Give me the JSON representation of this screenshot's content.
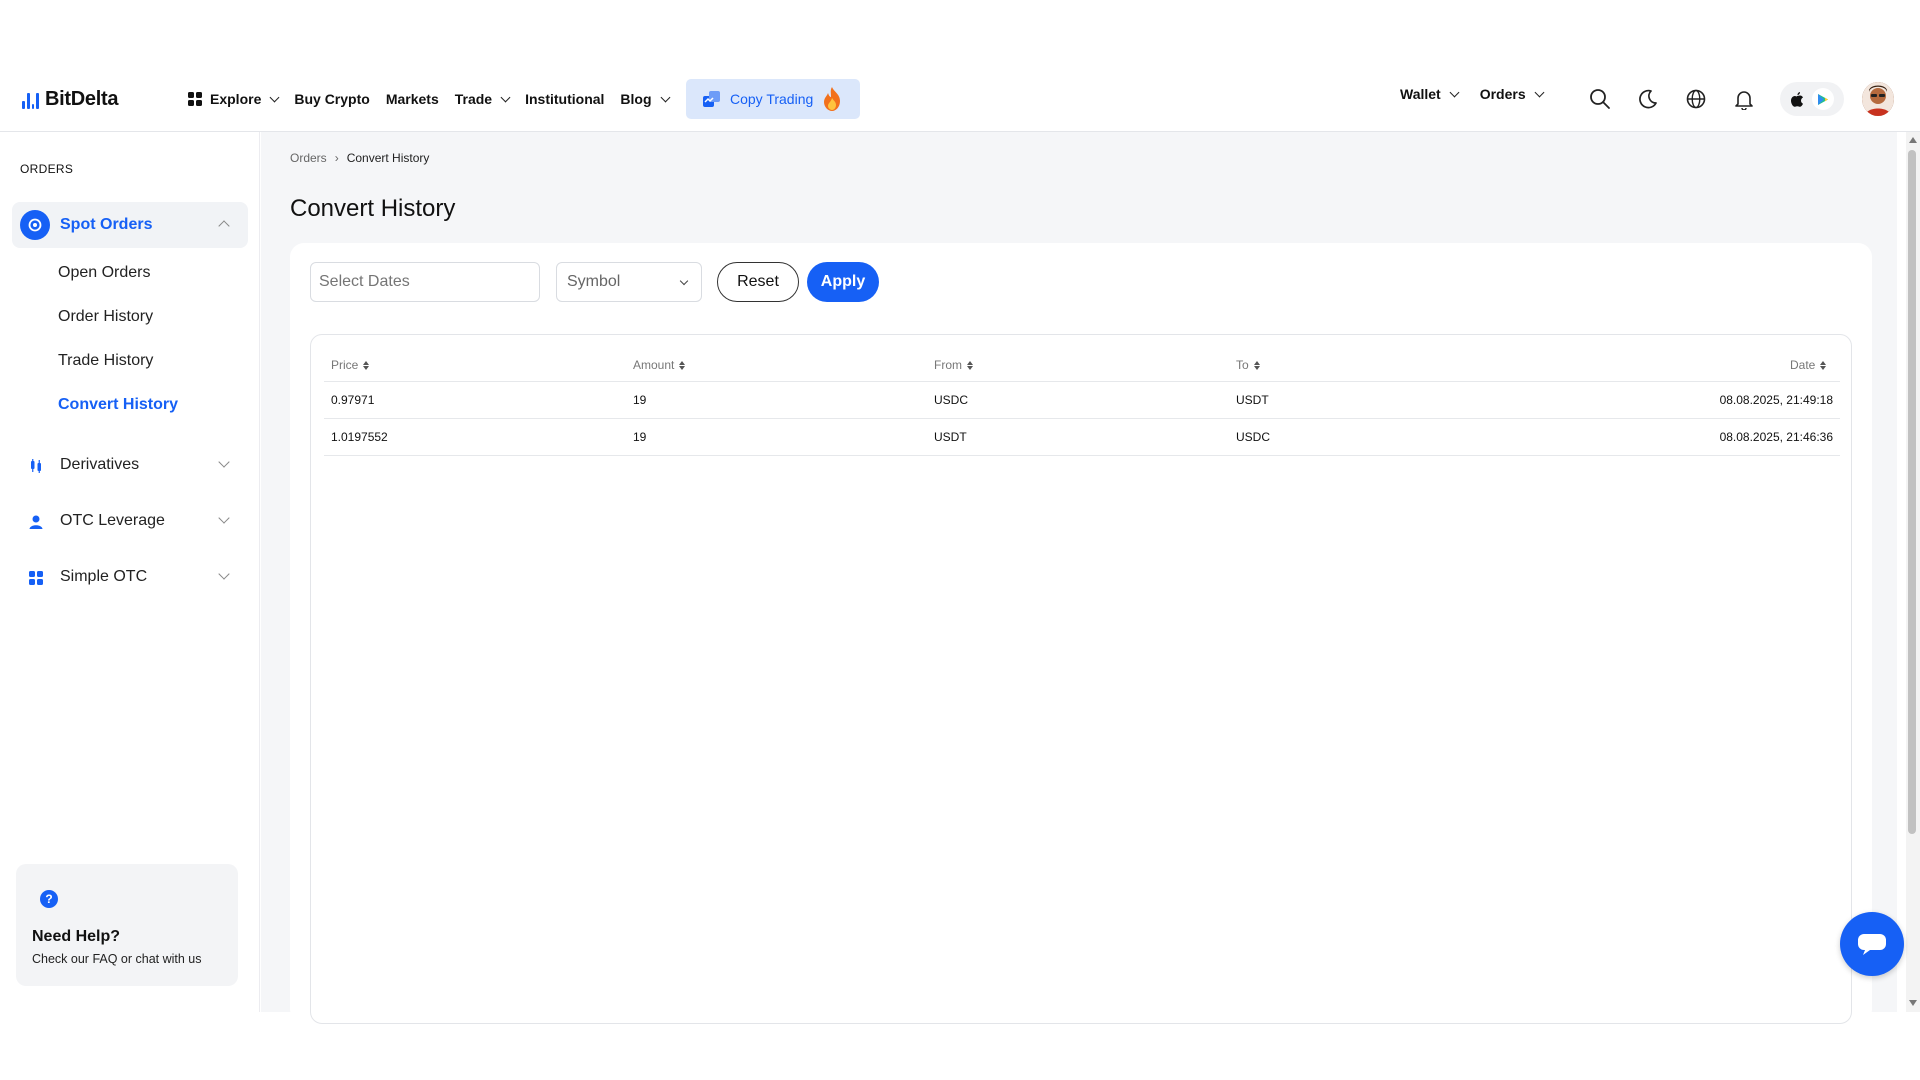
{
  "brand": {
    "name": "BitDelta",
    "accent": "#1660f5"
  },
  "nav": {
    "explore": "Explore",
    "buy_crypto": "Buy Crypto",
    "markets": "Markets",
    "trade": "Trade",
    "institutional": "Institutional",
    "blog": "Blog",
    "copy_trading": "Copy Trading",
    "wallet": "Wallet",
    "orders": "Orders"
  },
  "icons": [
    "grid-icon",
    "copy-trading-icon",
    "fire-icon",
    "search-icon",
    "moon-icon",
    "globe-icon",
    "bell-icon",
    "apple-icon",
    "google-play-icon",
    "avatar",
    "chat-icon"
  ],
  "sidebar": {
    "heading": "ORDERS",
    "spot_group": "Spot Orders",
    "spot_items": [
      "Open Orders",
      "Order History",
      "Trade History",
      "Convert History"
    ],
    "derivatives": "Derivatives",
    "otc_leverage": "OTC Leverage",
    "simple_otc": "Simple OTC",
    "help_title": "Need Help?",
    "help_sub": "Check our FAQ or chat with us"
  },
  "breadcrumb": {
    "root": "Orders",
    "current": "Convert History"
  },
  "page": {
    "title": "Convert History"
  },
  "filters": {
    "dates_placeholder": "Select Dates",
    "symbol_placeholder": "Symbol",
    "reset": "Reset",
    "apply": "Apply"
  },
  "table": {
    "headers": [
      "Price",
      "Amount",
      "From",
      "To",
      "Date"
    ],
    "rows": [
      [
        "0.97971",
        "19",
        "USDC",
        "USDT",
        "08.08.2025, 21:49:18"
      ],
      [
        "1.0197552",
        "19",
        "USDT",
        "USDC",
        "08.08.2025, 21:46:36"
      ]
    ]
  }
}
